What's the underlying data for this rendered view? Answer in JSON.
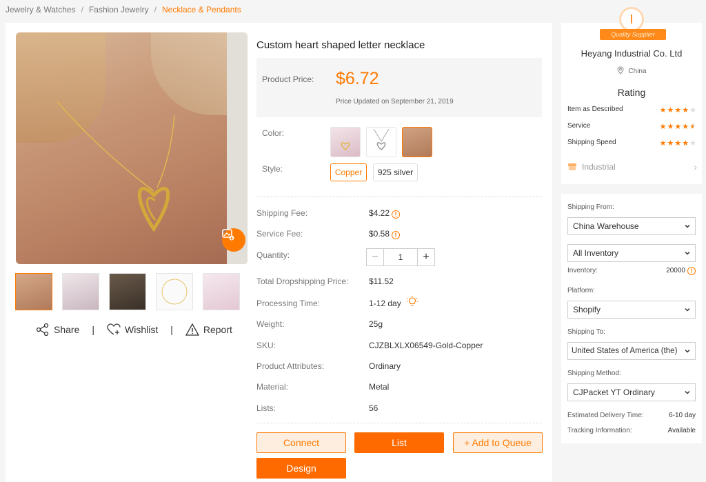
{
  "breadcrumb": {
    "items": [
      "Jewelry & Watches",
      "Fashion Jewelry",
      "Necklace & Pendants"
    ],
    "separator": "/"
  },
  "product": {
    "title": "Custom heart shaped letter necklace",
    "price_label": "Product Price:",
    "price": "$6.72",
    "price_updated": "Price Updated on September 21, 2019",
    "color_label": "Color:",
    "style_label": "Style:",
    "styles": [
      "Copper",
      "925 silver"
    ],
    "selected_style": "Copper",
    "details": [
      {
        "label": "Shipping Fee:",
        "value": "$4.22",
        "info": true
      },
      {
        "label": "Service Fee:",
        "value": "$0.58",
        "info": true
      },
      {
        "label": "Quantity:",
        "value": "1"
      },
      {
        "label": "Total Dropshipping Price:",
        "value": "$11.52"
      },
      {
        "label": "Processing Time:",
        "value": "1-12 day"
      },
      {
        "label": "Weight:",
        "value": "25g"
      },
      {
        "label": "SKU:",
        "value": "CJZBLXLX06549-Gold-Copper"
      },
      {
        "label": "Product Attributes:",
        "value": "Ordinary"
      },
      {
        "label": "Material:",
        "value": "Metal"
      },
      {
        "label": "Lists:",
        "value": "56"
      }
    ]
  },
  "gallery": {
    "share": "Share",
    "wishlist": "Wishlist",
    "report": "Report",
    "separator": "|"
  },
  "actions": {
    "connect": "Connect",
    "list": "List",
    "add_to_queue": "+ Add to Queue",
    "design": "Design"
  },
  "supplier": {
    "badge": "Quality Supplier",
    "badge_letter": "I",
    "name": "Heyang Industrial Co. Ltd",
    "location": "China",
    "rating_title": "Rating",
    "ratings": [
      {
        "label": "Item as Described",
        "stars": 4
      },
      {
        "label": "Service",
        "stars": 4.5
      },
      {
        "label": "Shipping Speed",
        "stars": 4
      }
    ],
    "category": "Industrial"
  },
  "shipping": {
    "from_label": "Shipping From:",
    "from_value": "China Warehouse",
    "inventory_select": "All Inventory",
    "inventory_label": "Inventory:",
    "inventory_value": "20000",
    "platform_label": "Platform:",
    "platform_value": "Shopify",
    "to_label": "Shipping To:",
    "to_value": "United States of America (the)",
    "method_label": "Shipping Method:",
    "method_value": "CJPacket YT Ordinary",
    "delivery_label": "Estimated Delivery Time:",
    "delivery_value": "6-10 day",
    "tracking_label": "Tracking Information:",
    "tracking_value": "Available"
  },
  "colors": {
    "accent": "#ff7a00",
    "accent_solid": "#ff6a00"
  }
}
